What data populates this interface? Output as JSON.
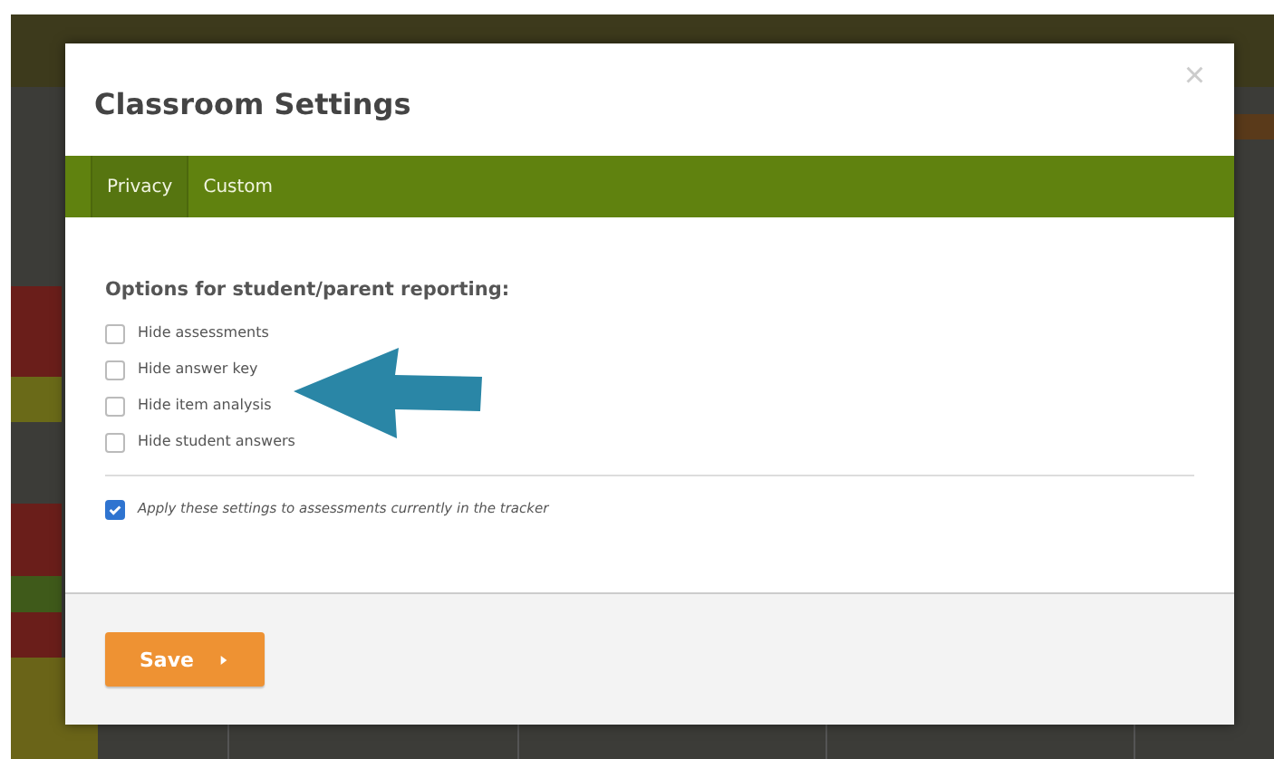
{
  "dialog": {
    "title": "Classroom Settings",
    "close": "×"
  },
  "tabs": [
    {
      "label": "Privacy",
      "selected": true
    },
    {
      "label": "Custom",
      "selected": false
    }
  ],
  "section_heading": "Options for student/parent reporting:",
  "options": [
    {
      "label": "Hide assessments",
      "checked": false
    },
    {
      "label": "Hide answer key",
      "checked": false
    },
    {
      "label": "Hide item analysis",
      "checked": false
    },
    {
      "label": "Hide student answers",
      "checked": false
    }
  ],
  "apply_option": {
    "label": "Apply these settings to assessments currently in the tracker",
    "checked": true
  },
  "buttons": [
    {
      "label": "Save"
    }
  ]
}
